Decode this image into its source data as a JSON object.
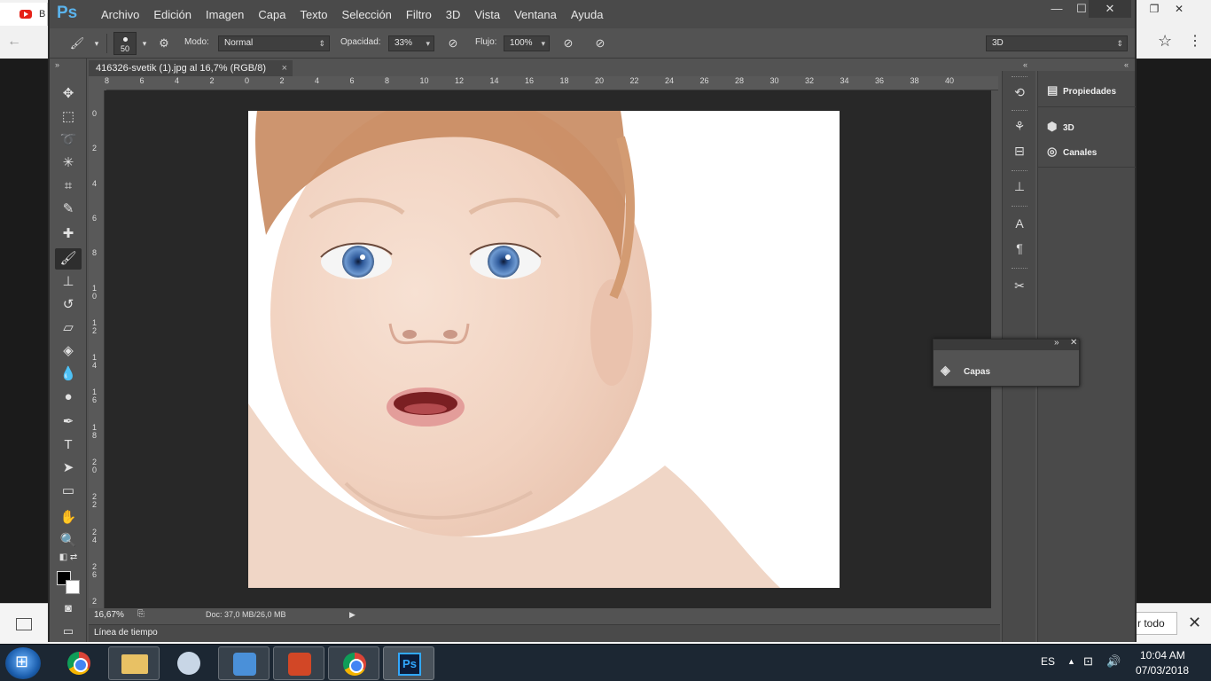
{
  "browser": {
    "tab_title": "B",
    "download_bar": {
      "show_all_label": "r todo",
      "close_icon": "close-icon"
    }
  },
  "photoshop": {
    "logo": "Ps",
    "menu": [
      "Archivo",
      "Edición",
      "Imagen",
      "Capa",
      "Texto",
      "Selección",
      "Filtro",
      "3D",
      "Vista",
      "Ventana",
      "Ayuda"
    ],
    "window_controls": {
      "minimize": "—",
      "maximize": "☐",
      "close": "✕"
    },
    "options": {
      "brush_size": "50",
      "mode_label": "Modo:",
      "mode_value": "Normal",
      "opacity_label": "Opacidad:",
      "opacity_value": "33%",
      "flow_label": "Flujo:",
      "flow_value": "100%",
      "workspace_value": "3D"
    },
    "document": {
      "tab_title": "416326-svetik (1).jpg al 16,7% (RGB/8)",
      "tab_close": "×",
      "zoom": "16,67%",
      "doc_info": "Doc: 37,0 MB/26,0 MB",
      "ruler_h": [
        "8",
        "6",
        "4",
        "2",
        "0",
        "2",
        "4",
        "6",
        "8",
        "10",
        "12",
        "14",
        "16",
        "18",
        "20",
        "22",
        "24",
        "26",
        "28",
        "30",
        "32",
        "34",
        "36",
        "38",
        "40"
      ],
      "ruler_v": [
        "0",
        "2",
        "4",
        "6",
        "8",
        "1 0",
        "1 2",
        "1 4",
        "1 6",
        "1 8",
        "2 0",
        "2 2",
        "2 4",
        "2 6",
        "2"
      ]
    },
    "timeline_label": "Línea de tiempo",
    "panels": {
      "properties": "Propiedades",
      "three_d": "3D",
      "channels": "Canales",
      "layers": "Capas"
    }
  },
  "taskbar": {
    "language": "ES",
    "time": "10:04 AM",
    "date": "07/03/2018"
  }
}
